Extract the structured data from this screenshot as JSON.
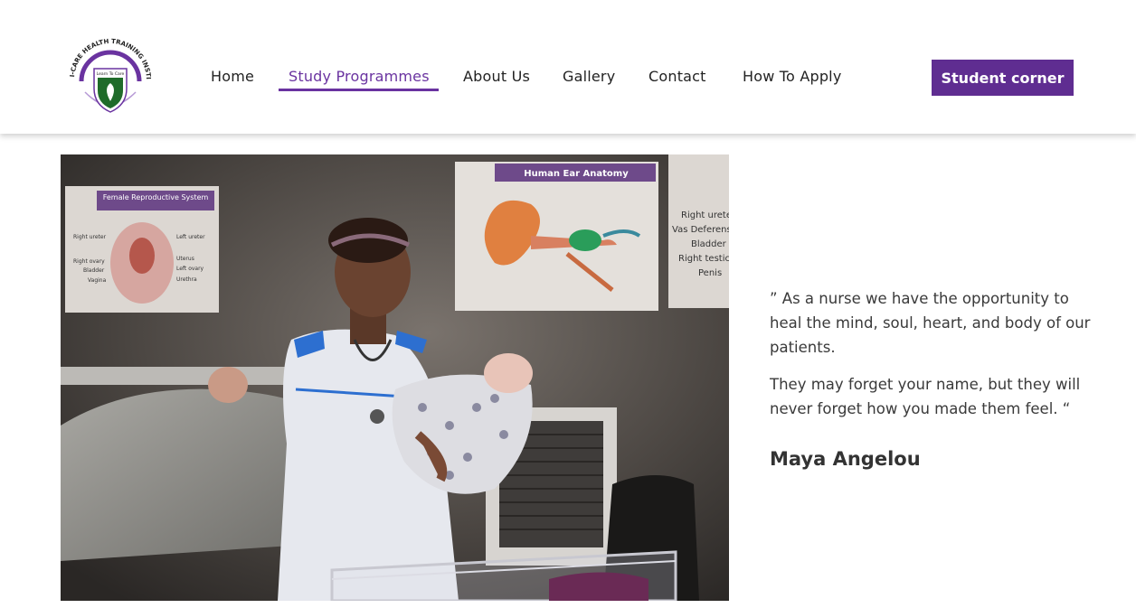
{
  "logo": {
    "arc_text": "I-CARE HEALTH TRAINING INSTITUTE",
    "motto": "Learn To Care"
  },
  "nav": {
    "items": [
      {
        "label": "Home",
        "active": false
      },
      {
        "label": "Study Programmes",
        "active": true
      },
      {
        "label": "About Us",
        "active": false
      },
      {
        "label": "Gallery",
        "active": false
      },
      {
        "label": "Contact",
        "active": false
      },
      {
        "label": "How To Apply",
        "active": false
      }
    ],
    "cta_label": "Student corner"
  },
  "colors": {
    "accent": "#5f2d91",
    "logo_green": "#1f6b2a"
  },
  "photo": {
    "poster_left_title": "Female Reproductive System",
    "poster_left_labels": [
      "Right ureter",
      "Left ureter",
      "Right ovary",
      "Uterus",
      "Bladder",
      "Left ovary",
      "Vagina",
      "Urethra"
    ],
    "poster_center_title": "Human Ear Anatomy",
    "poster_right_labels": [
      "Right ureter",
      "Vas Deferens",
      "Bladder",
      "Right testicle",
      "Penis"
    ]
  },
  "quote": {
    "line1": "” As a nurse we have the opportunity to heal the mind, soul, heart, and body of our patients.",
    "line2": "They may forget your name, but they will never forget how you made them feel. “",
    "author": "Maya Angelou"
  }
}
